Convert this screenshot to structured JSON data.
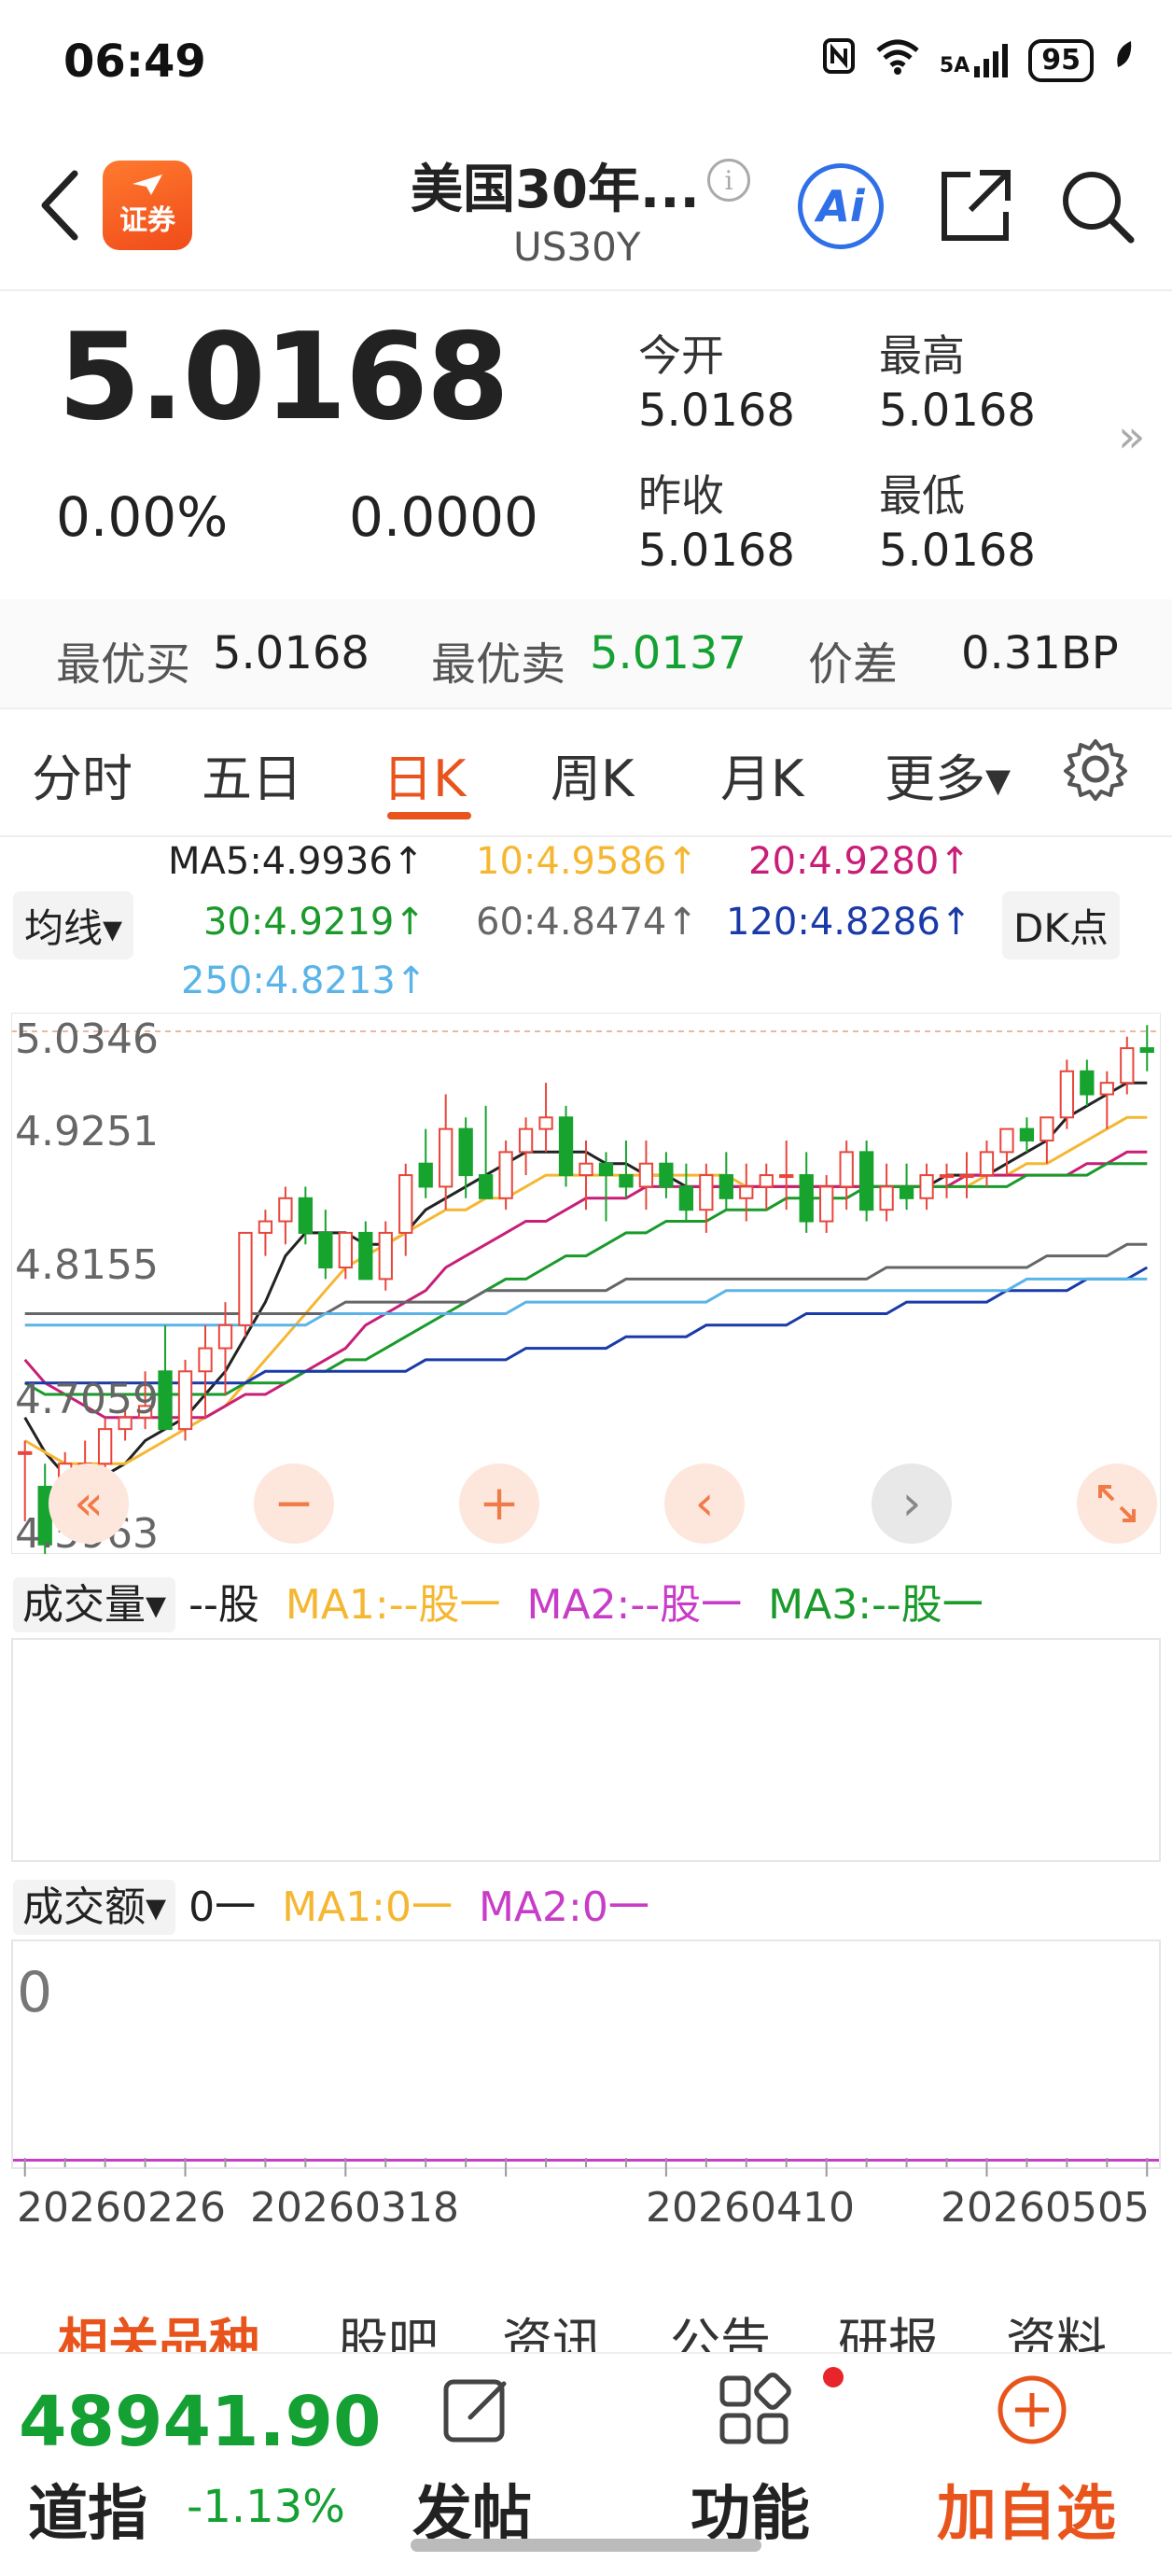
{
  "status_bar": {
    "time": "06:49",
    "battery": "95",
    "network": "5A"
  },
  "header": {
    "app_logo": "证券",
    "title": "美国30年...",
    "subtitle": "US30Y",
    "ai_label": "Ai"
  },
  "quote": {
    "price": "5.0168",
    "change_pct": "0.00%",
    "change_value": "0.0000",
    "open_label": "今开",
    "open_value": "5.0168",
    "high_label": "最高",
    "high_value": "5.0168",
    "prev_close_label": "昨收",
    "prev_close_value": "5.0168",
    "low_label": "最低",
    "low_value": "5.0168"
  },
  "bid_ask": {
    "best_bid_label": "最优买",
    "best_bid_value": "5.0168",
    "best_ask_label": "最优卖",
    "best_ask_value": "5.0137",
    "spread_label": "价差",
    "spread_value": "0.31BP"
  },
  "chart_tabs": [
    {
      "label": "分时",
      "active": false
    },
    {
      "label": "五日",
      "active": false
    },
    {
      "label": "日K",
      "active": true
    },
    {
      "label": "周K",
      "active": false
    },
    {
      "label": "月K",
      "active": false
    },
    {
      "label": "更多▾",
      "active": false
    }
  ],
  "ma_legend": {
    "selector": "均线▾",
    "dk_button": "DK点",
    "items": [
      {
        "text": "MA5:4.9936↑",
        "color": "#222222"
      },
      {
        "text": "10:4.9586↑",
        "color": "#f5b731"
      },
      {
        "text": "20:4.9280↑",
        "color": "#c81e78"
      },
      {
        "text": "30:4.9219↑",
        "color": "#1a9a2a"
      },
      {
        "text": "60:4.8474↑",
        "color": "#666666"
      },
      {
        "text": "120:4.8286↑",
        "color": "#1a3aa8"
      },
      {
        "text": "250:4.8213↑",
        "color": "#5ab4e8"
      }
    ]
  },
  "chart_data": {
    "type": "candlestick",
    "y_ticks": [
      "5.0346",
      "4.9251",
      "4.8155",
      "4.7059",
      "4.5963"
    ],
    "ylim": [
      4.5963,
      5.0346
    ],
    "reference_line": 5.0346,
    "up_color": "#e8463c",
    "down_color": "#16a32e",
    "candles": [
      [
        4.67,
        4.68,
        4.61,
        4.67
      ],
      [
        4.64,
        4.66,
        4.58,
        4.59
      ],
      [
        4.63,
        4.67,
        4.62,
        4.66
      ],
      [
        4.66,
        4.68,
        4.64,
        4.66
      ],
      [
        4.66,
        4.7,
        4.65,
        4.69
      ],
      [
        4.69,
        4.71,
        4.68,
        4.7
      ],
      [
        4.7,
        4.74,
        4.69,
        4.71
      ],
      [
        4.74,
        4.78,
        4.72,
        4.69
      ],
      [
        4.69,
        4.75,
        4.68,
        4.74
      ],
      [
        4.74,
        4.78,
        4.7,
        4.76
      ],
      [
        4.76,
        4.8,
        4.72,
        4.78
      ],
      [
        4.78,
        4.86,
        4.77,
        4.86
      ],
      [
        4.86,
        4.88,
        4.84,
        4.87
      ],
      [
        4.87,
        4.9,
        4.85,
        4.89
      ],
      [
        4.89,
        4.9,
        4.85,
        4.86
      ],
      [
        4.86,
        4.88,
        4.82,
        4.83
      ],
      [
        4.83,
        4.86,
        4.82,
        4.86
      ],
      [
        4.86,
        4.87,
        4.82,
        4.82
      ],
      [
        4.82,
        4.87,
        4.81,
        4.86
      ],
      [
        4.86,
        4.92,
        4.84,
        4.91
      ],
      [
        4.92,
        4.95,
        4.89,
        4.9
      ],
      [
        4.9,
        4.98,
        4.88,
        4.95
      ],
      [
        4.95,
        4.96,
        4.89,
        4.91
      ],
      [
        4.91,
        4.97,
        4.89,
        4.89
      ],
      [
        4.89,
        4.94,
        4.88,
        4.93
      ],
      [
        4.93,
        4.96,
        4.91,
        4.95
      ],
      [
        4.95,
        4.99,
        4.93,
        4.96
      ],
      [
        4.96,
        4.97,
        4.9,
        4.91
      ],
      [
        4.91,
        4.94,
        4.88,
        4.92
      ],
      [
        4.92,
        4.93,
        4.87,
        4.91
      ],
      [
        4.91,
        4.94,
        4.89,
        4.9
      ],
      [
        4.9,
        4.94,
        4.88,
        4.92
      ],
      [
        4.92,
        4.93,
        4.89,
        4.9
      ],
      [
        4.9,
        4.92,
        4.87,
        4.88
      ],
      [
        4.88,
        4.92,
        4.86,
        4.91
      ],
      [
        4.91,
        4.93,
        4.88,
        4.89
      ],
      [
        4.89,
        4.92,
        4.87,
        4.9
      ],
      [
        4.9,
        4.92,
        4.88,
        4.91
      ],
      [
        4.91,
        4.94,
        4.88,
        4.91
      ],
      [
        4.91,
        4.93,
        4.86,
        4.87
      ],
      [
        4.87,
        4.91,
        4.86,
        4.9
      ],
      [
        4.9,
        4.94,
        4.88,
        4.93
      ],
      [
        4.93,
        4.94,
        4.87,
        4.88
      ],
      [
        4.88,
        4.92,
        4.87,
        4.9
      ],
      [
        4.9,
        4.92,
        4.88,
        4.89
      ],
      [
        4.89,
        4.92,
        4.88,
        4.91
      ],
      [
        4.91,
        4.92,
        4.89,
        4.91
      ],
      [
        4.91,
        4.93,
        4.89,
        4.91
      ],
      [
        4.91,
        4.94,
        4.9,
        4.93
      ],
      [
        4.93,
        4.95,
        4.91,
        4.95
      ],
      [
        4.95,
        4.96,
        4.93,
        4.94
      ],
      [
        4.94,
        4.96,
        4.92,
        4.96
      ],
      [
        4.96,
        5.01,
        4.95,
        5.0
      ],
      [
        5.0,
        5.01,
        4.97,
        4.98
      ],
      [
        4.98,
        5.0,
        4.95,
        4.99
      ],
      [
        4.99,
        5.03,
        4.98,
        5.02
      ],
      [
        5.02,
        5.04,
        5.0,
        5.0168
      ]
    ],
    "ma_series": [
      {
        "name": "MA5",
        "color": "#222222",
        "values": [
          4.7,
          4.67,
          4.65,
          4.64,
          4.65,
          4.66,
          4.68,
          4.69,
          4.7,
          4.72,
          4.74,
          4.77,
          4.8,
          4.84,
          4.86,
          4.86,
          4.86,
          4.85,
          4.85,
          4.86,
          4.88,
          4.89,
          4.9,
          4.91,
          4.92,
          4.93,
          4.93,
          4.93,
          4.93,
          4.92,
          4.92,
          4.91,
          4.91,
          4.9,
          4.9,
          4.9,
          4.9,
          4.9,
          4.9,
          4.9,
          4.9,
          4.9,
          4.9,
          4.9,
          4.9,
          4.9,
          4.91,
          4.91,
          4.91,
          4.92,
          4.93,
          4.94,
          4.96,
          4.97,
          4.98,
          4.99,
          4.99
        ]
      },
      {
        "name": "MA10",
        "color": "#f5b731",
        "values": [
          4.68,
          4.67,
          4.66,
          4.66,
          4.66,
          4.66,
          4.67,
          4.68,
          4.69,
          4.7,
          4.71,
          4.73,
          4.75,
          4.77,
          4.79,
          4.81,
          4.83,
          4.84,
          4.85,
          4.86,
          4.87,
          4.88,
          4.88,
          4.89,
          4.89,
          4.9,
          4.91,
          4.91,
          4.91,
          4.91,
          4.91,
          4.91,
          4.91,
          4.91,
          4.91,
          4.91,
          4.9,
          4.9,
          4.9,
          4.9,
          4.9,
          4.9,
          4.9,
          4.9,
          4.9,
          4.9,
          4.9,
          4.9,
          4.91,
          4.91,
          4.92,
          4.92,
          4.93,
          4.94,
          4.95,
          4.96,
          4.96
        ]
      },
      {
        "name": "MA20",
        "color": "#c81e78",
        "values": [
          4.75,
          4.73,
          4.72,
          4.71,
          4.7,
          4.7,
          4.7,
          4.7,
          4.7,
          4.7,
          4.71,
          4.72,
          4.72,
          4.73,
          4.74,
          4.75,
          4.76,
          4.78,
          4.79,
          4.8,
          4.81,
          4.83,
          4.84,
          4.85,
          4.86,
          4.87,
          4.87,
          4.88,
          4.89,
          4.89,
          4.89,
          4.9,
          4.9,
          4.9,
          4.9,
          4.9,
          4.9,
          4.9,
          4.9,
          4.9,
          4.9,
          4.9,
          4.9,
          4.9,
          4.9,
          4.9,
          4.9,
          4.91,
          4.91,
          4.91,
          4.91,
          4.91,
          4.91,
          4.92,
          4.92,
          4.93,
          4.93
        ]
      },
      {
        "name": "MA30",
        "color": "#1a9a2a",
        "values": [
          4.73,
          4.72,
          4.72,
          4.72,
          4.72,
          4.72,
          4.72,
          4.72,
          4.72,
          4.72,
          4.72,
          4.73,
          4.73,
          4.73,
          4.74,
          4.74,
          4.75,
          4.75,
          4.76,
          4.77,
          4.78,
          4.79,
          4.8,
          4.81,
          4.82,
          4.82,
          4.83,
          4.84,
          4.84,
          4.85,
          4.86,
          4.86,
          4.87,
          4.87,
          4.87,
          4.88,
          4.88,
          4.88,
          4.89,
          4.89,
          4.89,
          4.89,
          4.9,
          4.9,
          4.9,
          4.9,
          4.9,
          4.9,
          4.9,
          4.9,
          4.91,
          4.91,
          4.91,
          4.91,
          4.92,
          4.92,
          4.92
        ]
      },
      {
        "name": "MA60",
        "color": "#666666",
        "values": [
          4.79,
          4.79,
          4.79,
          4.79,
          4.79,
          4.79,
          4.79,
          4.79,
          4.79,
          4.79,
          4.79,
          4.79,
          4.79,
          4.79,
          4.79,
          4.79,
          4.8,
          4.8,
          4.8,
          4.8,
          4.8,
          4.8,
          4.8,
          4.81,
          4.81,
          4.81,
          4.81,
          4.81,
          4.81,
          4.81,
          4.82,
          4.82,
          4.82,
          4.82,
          4.82,
          4.82,
          4.82,
          4.82,
          4.82,
          4.82,
          4.82,
          4.82,
          4.82,
          4.83,
          4.83,
          4.83,
          4.83,
          4.83,
          4.83,
          4.83,
          4.83,
          4.84,
          4.84,
          4.84,
          4.84,
          4.85,
          4.85
        ]
      },
      {
        "name": "MA120",
        "color": "#1a3aa8",
        "values": [
          4.73,
          4.73,
          4.73,
          4.73,
          4.73,
          4.73,
          4.73,
          4.73,
          4.73,
          4.73,
          4.73,
          4.73,
          4.74,
          4.74,
          4.74,
          4.74,
          4.74,
          4.74,
          4.74,
          4.74,
          4.75,
          4.75,
          4.75,
          4.75,
          4.75,
          4.76,
          4.76,
          4.76,
          4.76,
          4.76,
          4.77,
          4.77,
          4.77,
          4.77,
          4.78,
          4.78,
          4.78,
          4.78,
          4.78,
          4.79,
          4.79,
          4.79,
          4.79,
          4.79,
          4.8,
          4.8,
          4.8,
          4.8,
          4.8,
          4.81,
          4.81,
          4.81,
          4.81,
          4.82,
          4.82,
          4.82,
          4.83
        ]
      },
      {
        "name": "MA250",
        "color": "#5ab4e8",
        "values": [
          4.78,
          4.78,
          4.78,
          4.78,
          4.78,
          4.78,
          4.78,
          4.78,
          4.78,
          4.78,
          4.78,
          4.78,
          4.78,
          4.78,
          4.78,
          4.79,
          4.79,
          4.79,
          4.79,
          4.79,
          4.79,
          4.79,
          4.79,
          4.79,
          4.79,
          4.8,
          4.8,
          4.8,
          4.8,
          4.8,
          4.8,
          4.8,
          4.8,
          4.8,
          4.8,
          4.81,
          4.81,
          4.81,
          4.81,
          4.81,
          4.81,
          4.81,
          4.81,
          4.81,
          4.81,
          4.81,
          4.81,
          4.81,
          4.81,
          4.81,
          4.82,
          4.82,
          4.82,
          4.82,
          4.82,
          4.82,
          4.82
        ]
      }
    ],
    "x_ticks": [
      "20260226",
      "20260318",
      "20260410",
      "20260505"
    ]
  },
  "volume_panel": {
    "selector": "成交量▾",
    "value": "--股",
    "ma1": "MA1:--股一",
    "ma2": "MA2:--股一",
    "ma3": "MA3:--股一"
  },
  "turnover_panel": {
    "selector": "成交额▾",
    "value": "0一",
    "ma1": "MA1:0一",
    "ma2": "MA2:0一",
    "zero_label": "0"
  },
  "bottom_tabs": [
    "相关品种",
    "股吧",
    "资讯",
    "公告",
    "研报",
    "资料"
  ],
  "bottom_bar": {
    "index_value": "48941.90",
    "index_name": "道指",
    "index_change": "-1.13%",
    "post_label": "发帖",
    "function_label": "功能",
    "add_watch_label": "加自选"
  }
}
